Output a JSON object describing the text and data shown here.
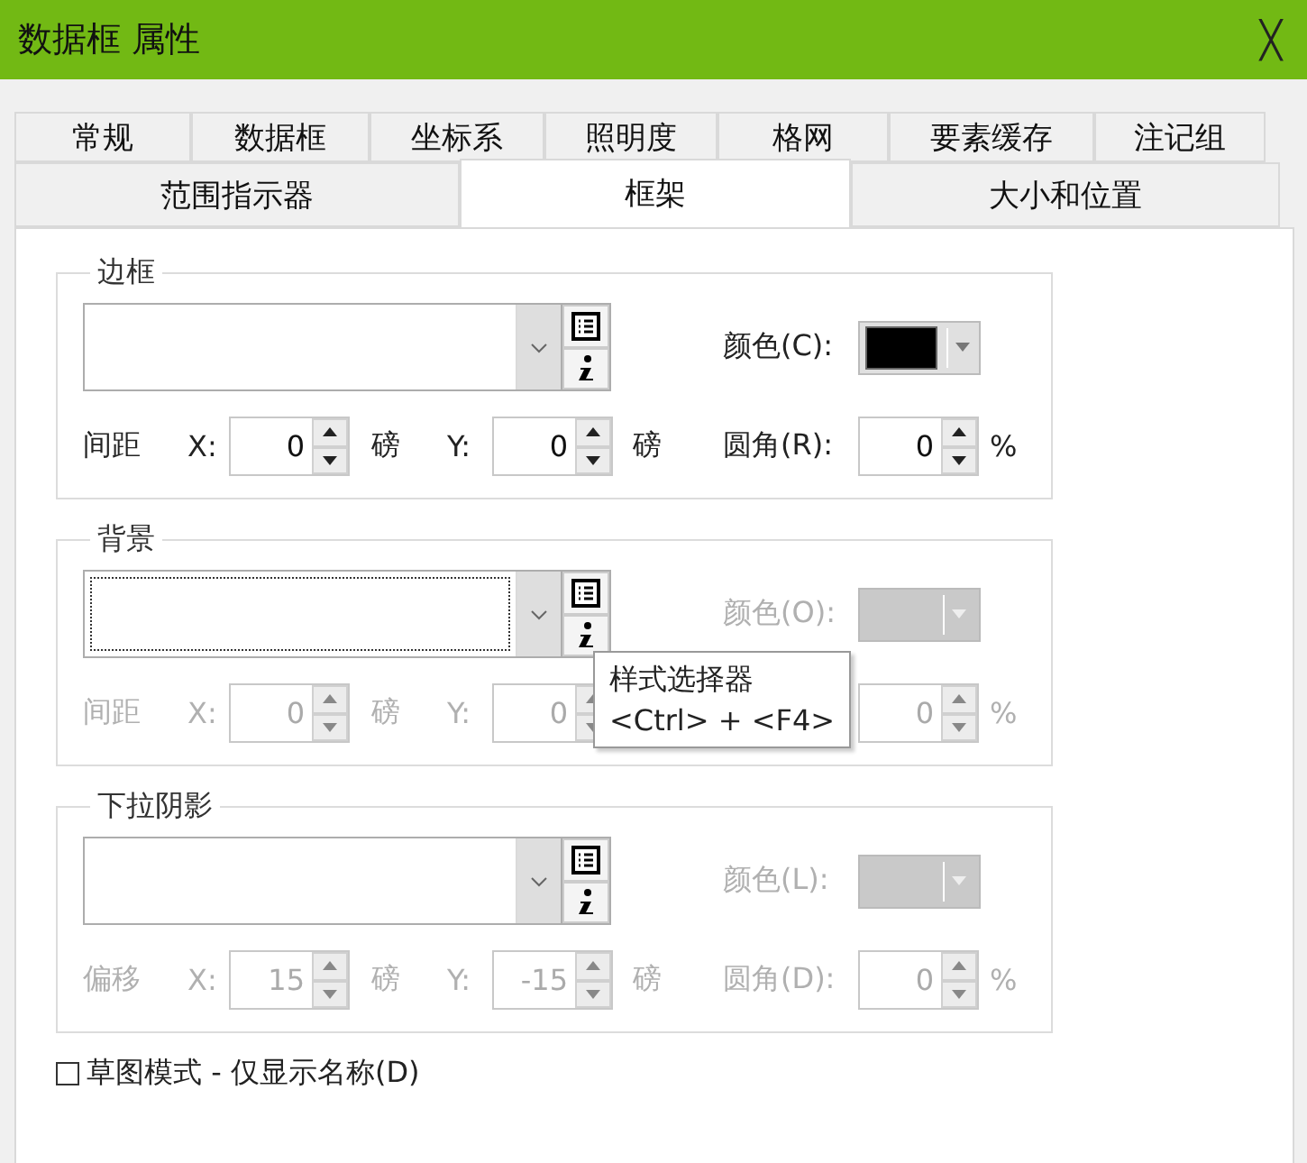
{
  "window": {
    "title": "数据框 属性",
    "close": "╳"
  },
  "tabs_row_1": [
    {
      "label": "常规",
      "selected": false
    },
    {
      "label": "数据框",
      "selected": false
    },
    {
      "label": "坐标系",
      "selected": false
    },
    {
      "label": "照明度",
      "selected": false
    },
    {
      "label": "格网",
      "selected": false
    },
    {
      "label": "要素缓存",
      "selected": false
    },
    {
      "label": "注记组",
      "selected": false
    }
  ],
  "tabs_row_2": [
    {
      "label": "范围指示器",
      "selected": false
    },
    {
      "label": "框架",
      "selected": true
    },
    {
      "label": "大小和位置",
      "selected": false
    }
  ],
  "groups": [
    {
      "title": "边框",
      "disabled": false,
      "focused": false,
      "color_label": "颜色(C):",
      "color": "#000000",
      "row": {
        "label": "间距",
        "x_label": "X:",
        "x_value": "0",
        "x_unit": "磅",
        "y_label": "Y:",
        "y_value": "0",
        "y_unit": "磅",
        "corner_label": "圆角(R):",
        "corner_value": "0",
        "corner_unit": "%"
      }
    },
    {
      "title": "背景",
      "disabled": true,
      "focused": true,
      "color_label": "颜色(O):",
      "row": {
        "label": "间距",
        "x_label": "X:",
        "x_value": "0",
        "x_unit": "磅",
        "y_label": "Y:",
        "y_value": "0",
        "corner_value": "0",
        "corner_unit": "%"
      }
    },
    {
      "title": "下拉阴影",
      "disabled": true,
      "focused": false,
      "color_label": "颜色(L):",
      "row": {
        "label": "偏移",
        "x_label": "X:",
        "x_value": "15",
        "x_unit": "磅",
        "y_label": "Y:",
        "y_value": "-15",
        "y_unit": "磅",
        "corner_label": "圆角(D):",
        "corner_value": "0",
        "corner_unit": "%"
      }
    }
  ],
  "tooltip": {
    "title": "样式选择器",
    "shortcut": "<Ctrl> + <F4>"
  },
  "draft_mode": {
    "label": "草图模式 - 仅显示名称(D)",
    "checked": false
  }
}
